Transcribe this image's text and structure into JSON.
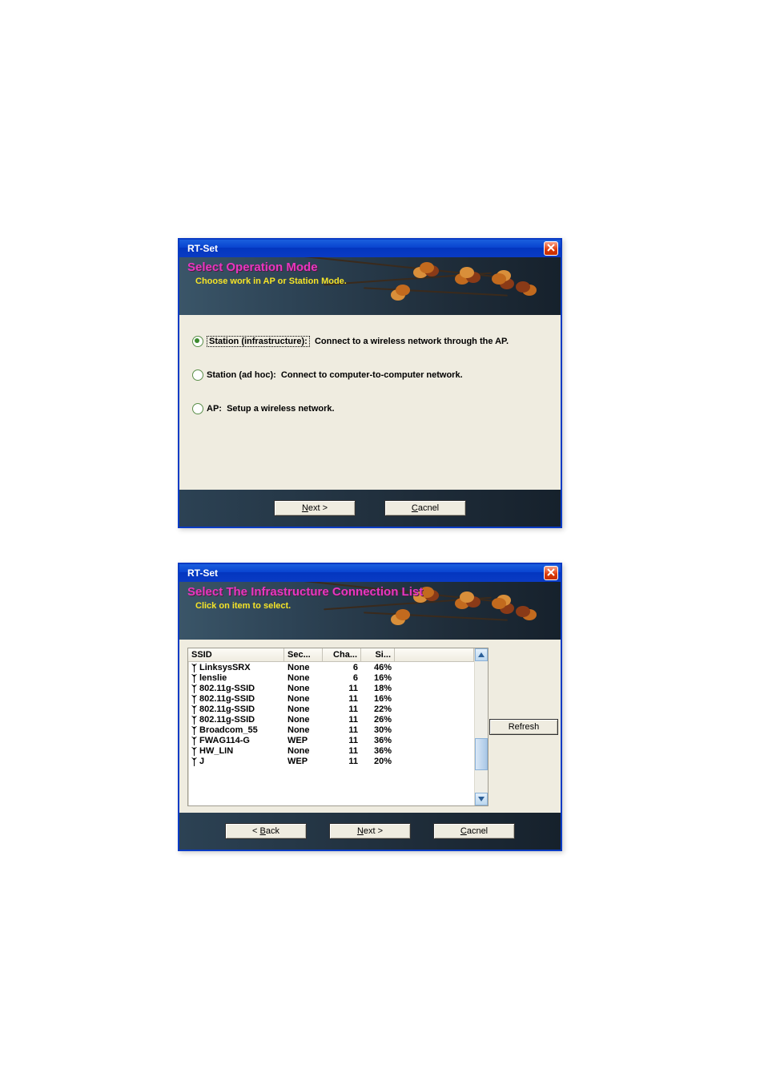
{
  "dialog1": {
    "title": "RT-Set",
    "banner_title": "Select Operation Mode",
    "banner_sub": "Choose work in AP or Station Mode.",
    "options": [
      {
        "label": "Station (infrastructure):",
        "desc": "Connect to a wireless network through the AP.",
        "selected": true
      },
      {
        "label": "Station (ad hoc):",
        "desc": "Connect to computer-to-computer network.",
        "selected": false
      },
      {
        "label": "AP:",
        "desc": "Setup a wireless network.",
        "selected": false
      }
    ],
    "buttons": {
      "next": "Next >",
      "cancel": "Cacnel"
    }
  },
  "dialog2": {
    "title": "RT-Set",
    "banner_title": "Select The Infrastructure Connection List",
    "banner_sub": "Click on item to select.",
    "columns": {
      "ssid": "SSID",
      "sec": "Sec...",
      "cha": "Cha...",
      "sig": "Si..."
    },
    "rows": [
      {
        "ssid": "LinksysSRX",
        "sec": "None",
        "cha": "6",
        "sig": "46%"
      },
      {
        "ssid": "lenslie",
        "sec": "None",
        "cha": "6",
        "sig": "16%"
      },
      {
        "ssid": "802.11g-SSID",
        "sec": "None",
        "cha": "11",
        "sig": "18%"
      },
      {
        "ssid": "802.11g-SSID",
        "sec": "None",
        "cha": "11",
        "sig": "16%"
      },
      {
        "ssid": "802.11g-SSID",
        "sec": "None",
        "cha": "11",
        "sig": "22%"
      },
      {
        "ssid": "802.11g-SSID",
        "sec": "None",
        "cha": "11",
        "sig": "26%"
      },
      {
        "ssid": "Broadcom_55",
        "sec": "None",
        "cha": "11",
        "sig": "30%"
      },
      {
        "ssid": "FWAG114-G",
        "sec": "WEP",
        "cha": "11",
        "sig": "36%"
      },
      {
        "ssid": "HW_LIN",
        "sec": "None",
        "cha": "11",
        "sig": "36%"
      },
      {
        "ssid": "J",
        "sec": "WEP",
        "cha": "11",
        "sig": "20%"
      }
    ],
    "buttons": {
      "back": "< Back",
      "next": "Next >",
      "cancel": "Cacnel",
      "refresh": "Refresh"
    }
  }
}
